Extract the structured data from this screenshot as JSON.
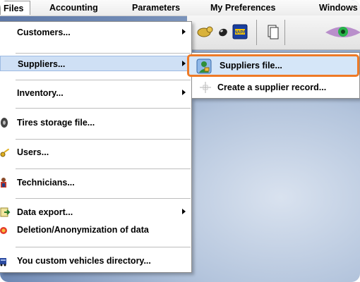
{
  "menubar": {
    "files": "Files",
    "accounting": "Accounting",
    "parameters": "Parameters",
    "preferences": "My Preferences",
    "windows": "Windows"
  },
  "toolbar": {
    "icons": [
      "tire-icon",
      "car-pedal-icon",
      "napa-icon",
      "copy-icon",
      "eye-icon"
    ]
  },
  "files_menu": {
    "items": [
      {
        "label": "Customers...",
        "submenu": true
      },
      {
        "label": "Suppliers...",
        "submenu": true,
        "highlighted": true
      },
      {
        "label": "Inventory...",
        "submenu": true
      },
      {
        "label": "Tires storage file..."
      },
      {
        "label": "Users..."
      },
      {
        "label": "Technicians..."
      },
      {
        "label": "Data export...",
        "submenu": true
      },
      {
        "label": "Deletion/Anonymization of data"
      },
      {
        "label": "You custom vehicles directory..."
      }
    ]
  },
  "suppliers_submenu": {
    "items": [
      {
        "label": "Suppliers file...",
        "highlighted": true
      },
      {
        "label": "Create a supplier record..."
      }
    ]
  },
  "colors": {
    "highlight": "#cfe0f5",
    "callout_border": "#ee7a26",
    "background": "#6f89b4"
  }
}
